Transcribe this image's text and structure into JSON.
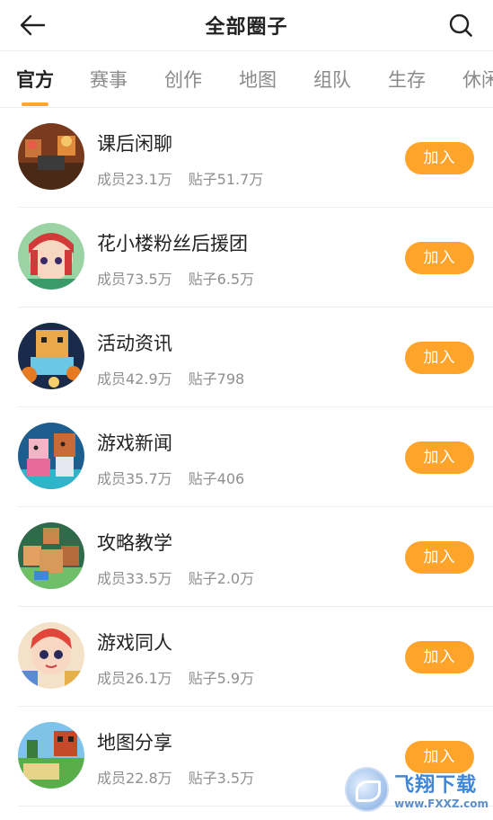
{
  "header": {
    "title": "全部圈子"
  },
  "tabs": [
    {
      "label": "官方",
      "active": true
    },
    {
      "label": "赛事",
      "active": false
    },
    {
      "label": "创作",
      "active": false
    },
    {
      "label": "地图",
      "active": false
    },
    {
      "label": "组队",
      "active": false
    },
    {
      "label": "生存",
      "active": false
    },
    {
      "label": "休闲",
      "active": false
    }
  ],
  "accent_color": "#ffa42b",
  "circles": [
    {
      "name": "课后闲聊",
      "members": "成员23.1万",
      "posts": "贴子51.7万",
      "join": "加入"
    },
    {
      "name": "花小楼粉丝后援团",
      "members": "成员73.5万",
      "posts": "贴子6.5万",
      "join": "加入"
    },
    {
      "name": "活动资讯",
      "members": "成员42.9万",
      "posts": "贴子798",
      "join": "加入"
    },
    {
      "name": "游戏新闻",
      "members": "成员35.7万",
      "posts": "贴子406",
      "join": "加入"
    },
    {
      "name": "攻略教学",
      "members": "成员33.5万",
      "posts": "贴子2.0万",
      "join": "加入"
    },
    {
      "name": "游戏同人",
      "members": "成员26.1万",
      "posts": "贴子5.9万",
      "join": "加入"
    },
    {
      "name": "地图分享",
      "members": "成员22.8万",
      "posts": "贴子3.5万",
      "join": "加入"
    }
  ],
  "watermark": {
    "text": "飞翔下载",
    "url": "www.FXXZ.com"
  }
}
